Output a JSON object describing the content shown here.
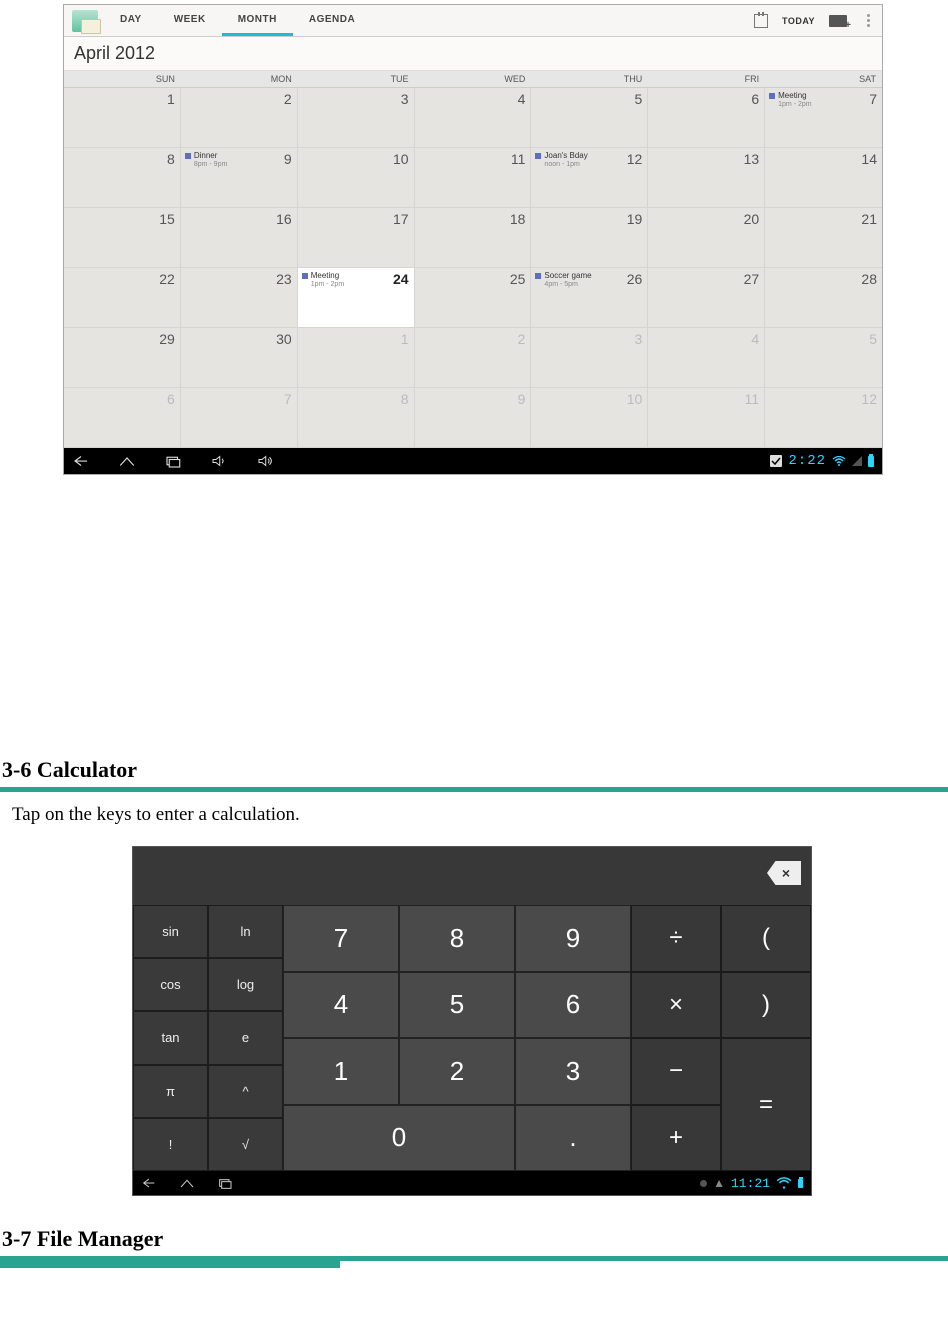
{
  "calendar": {
    "tabs": {
      "day": "DAY",
      "week": "WEEK",
      "month": "MONTH",
      "agenda": "AGENDA",
      "active": "month"
    },
    "today_label": "TODAY",
    "month_title": "April 2012",
    "day_headers": [
      "SUN",
      "MON",
      "TUE",
      "WED",
      "THU",
      "FRI",
      "SAT"
    ],
    "today_date": 24,
    "weeks": [
      [
        {
          "n": 1
        },
        {
          "n": 2
        },
        {
          "n": 3
        },
        {
          "n": 4
        },
        {
          "n": 5
        },
        {
          "n": 6
        },
        {
          "n": 7,
          "evt": {
            "title": "Meeting",
            "time": "1pm - 2pm"
          }
        }
      ],
      [
        {
          "n": 8
        },
        {
          "n": 9,
          "evt": {
            "title": "Dinner",
            "time": "8pm - 9pm"
          }
        },
        {
          "n": 10
        },
        {
          "n": 11
        },
        {
          "n": 12,
          "evt": {
            "title": "Joan's Bday",
            "time": "noon - 1pm"
          }
        },
        {
          "n": 13
        },
        {
          "n": 14
        }
      ],
      [
        {
          "n": 15
        },
        {
          "n": 16
        },
        {
          "n": 17
        },
        {
          "n": 18
        },
        {
          "n": 19
        },
        {
          "n": 20
        },
        {
          "n": 21
        }
      ],
      [
        {
          "n": 22
        },
        {
          "n": 23
        },
        {
          "n": 24,
          "today": true,
          "evt": {
            "title": "Meeting",
            "time": "1pm - 2pm"
          }
        },
        {
          "n": 25
        },
        {
          "n": 26,
          "evt": {
            "title": "Soccer game",
            "time": "4pm - 5pm"
          }
        },
        {
          "n": 27
        },
        {
          "n": 28
        }
      ],
      [
        {
          "n": 29
        },
        {
          "n": 30
        },
        {
          "n": 1,
          "other": true
        },
        {
          "n": 2,
          "other": true
        },
        {
          "n": 3,
          "other": true
        },
        {
          "n": 4,
          "other": true
        },
        {
          "n": 5,
          "other": true
        }
      ],
      [
        {
          "n": 6,
          "other": true
        },
        {
          "n": 7,
          "other": true
        },
        {
          "n": 8,
          "other": true
        },
        {
          "n": 9,
          "other": true
        },
        {
          "n": 10,
          "other": true
        },
        {
          "n": 11,
          "other": true
        },
        {
          "n": 12,
          "other": true
        }
      ]
    ],
    "status_time": "2:22"
  },
  "section_calculator": {
    "heading": "3-6 Calculator",
    "body": "Tap on the keys to enter a calculation."
  },
  "calculator": {
    "fn_keys": [
      "sin",
      "ln",
      "cos",
      "log",
      "tan",
      "e",
      "π",
      "^",
      "!",
      "√"
    ],
    "num_keys": [
      "7",
      "8",
      "9",
      "4",
      "5",
      "6",
      "1",
      "2",
      "3",
      "0",
      "."
    ],
    "op_keys": {
      "div": "÷",
      "lp": "(",
      "mul": "×",
      "rp": ")",
      "sub": "−",
      "add": "+",
      "eq": "="
    },
    "status_time": "11:21"
  },
  "section_filemgr": {
    "heading": "3-7 File Manager"
  }
}
